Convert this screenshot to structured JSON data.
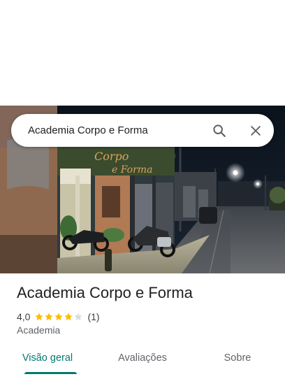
{
  "search": {
    "query": "Academia Corpo e Forma",
    "search_icon": "search-icon",
    "close_icon": "close-icon"
  },
  "photo": {
    "sign_text": "Corpo e Forma"
  },
  "place": {
    "name": "Academia Corpo e Forma",
    "rating": "4,0",
    "rating_value": 4.0,
    "max_stars": 5,
    "review_count": "(1)",
    "category": "Academia"
  },
  "tabs": [
    {
      "label": "Visão geral",
      "active": true
    },
    {
      "label": "Avaliações",
      "active": false
    },
    {
      "label": "Sobre",
      "active": false
    }
  ],
  "colors": {
    "accent": "#01796f",
    "star": "#fbbc04",
    "star_empty": "#dadce0"
  }
}
